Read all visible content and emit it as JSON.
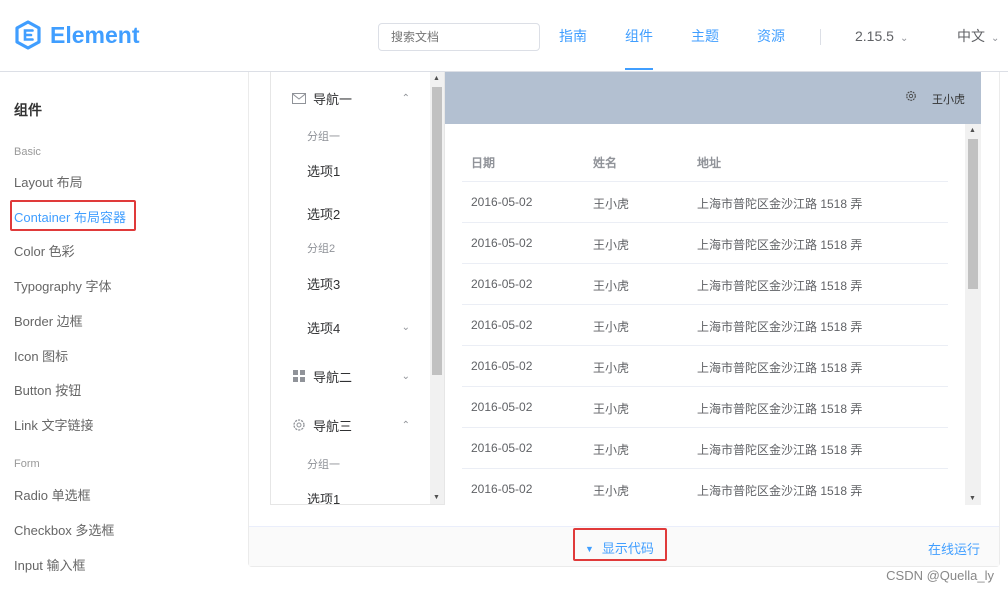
{
  "header": {
    "logo_text": "Element",
    "search_placeholder": "搜索文档",
    "nav": [
      "指南",
      "组件",
      "主题",
      "资源"
    ],
    "version": "2.15.5",
    "language": "中文",
    "accent_color": "#409eff"
  },
  "sidebar": {
    "title": "组件",
    "group_basic": "Basic",
    "items_basic": [
      "Layout 布局",
      "Container 布局容器",
      "Color 色彩",
      "Typography 字体",
      "Border 边框",
      "Icon 图标",
      "Button 按钮",
      "Link 文字链接"
    ],
    "group_form": "Form",
    "items_form": [
      "Radio 单选框",
      "Checkbox 多选框",
      "Input 输入框"
    ],
    "active_item": "Container 布局容器"
  },
  "menu": {
    "nav1": "导航一",
    "group1": "分组一",
    "opt1": "选项1",
    "opt2": "选项2",
    "group2": "分组2",
    "opt3": "选项3",
    "opt4": "选项4",
    "nav2": "导航二",
    "nav3": "导航三",
    "nav3_group1": "分组一",
    "nav3_opt1": "选项1"
  },
  "topbar": {
    "user": "王小虎",
    "color": "#b3c0d1"
  },
  "table": {
    "headers": [
      "日期",
      "姓名",
      "地址"
    ],
    "rows": [
      [
        "2016-05-02",
        "王小虎",
        "上海市普陀区金沙江路 1518 弄"
      ],
      [
        "2016-05-02",
        "王小虎",
        "上海市普陀区金沙江路 1518 弄"
      ],
      [
        "2016-05-02",
        "王小虎",
        "上海市普陀区金沙江路 1518 弄"
      ],
      [
        "2016-05-02",
        "王小虎",
        "上海市普陀区金沙江路 1518 弄"
      ],
      [
        "2016-05-02",
        "王小虎",
        "上海市普陀区金沙江路 1518 弄"
      ],
      [
        "2016-05-02",
        "王小虎",
        "上海市普陀区金沙江路 1518 弄"
      ],
      [
        "2016-05-02",
        "王小虎",
        "上海市普陀区金沙江路 1518 弄"
      ],
      [
        "2016-05-02",
        "王小虎",
        "上海市普陀区金沙江路 1518 弄"
      ]
    ]
  },
  "footer": {
    "show_code": "显示代码",
    "run_online": "在线运行",
    "watermark": "CSDN @Quella_ly"
  }
}
